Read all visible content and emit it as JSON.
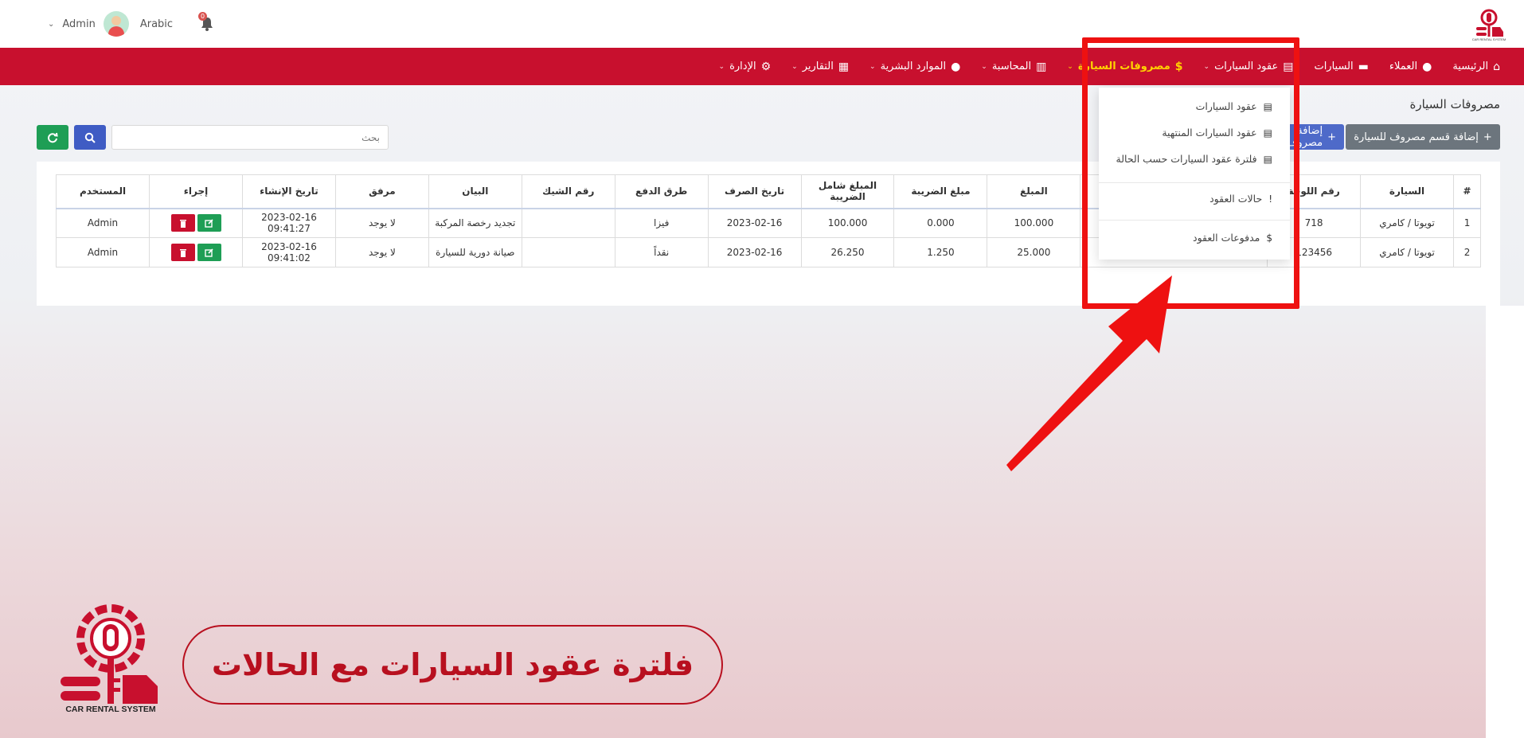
{
  "header": {
    "user_name": "Admin",
    "language": "Arabic",
    "notification_count": "0"
  },
  "nav": {
    "items": [
      {
        "label": "الرئيسية",
        "icon": "home-icon"
      },
      {
        "label": "العملاء",
        "icon": "user-icon"
      },
      {
        "label": "السيارات",
        "icon": "car-icon"
      },
      {
        "label": "عقود السيارات",
        "icon": "file-icon"
      },
      {
        "label": "مصروفات السيارة",
        "icon": "dollar-icon"
      },
      {
        "label": "المحاسبة",
        "icon": "bank-icon"
      },
      {
        "label": "الموارد البشرية",
        "icon": "users-icon"
      },
      {
        "label": "التقارير",
        "icon": "chart-icon"
      },
      {
        "label": "الإدارة",
        "icon": "gear-icon"
      }
    ]
  },
  "dropdown": {
    "items": [
      "عقود السيارات",
      "عقود السيارات المنتهية",
      "فلترة عقود السيارات حسب الحالة",
      "حالات العقود",
      "مدفوعات العقود"
    ]
  },
  "page": {
    "title": "مصروفات السيارة",
    "add_category_label": "إضافة قسم مصروف للسيارة",
    "add_label": "إضافة مصروف",
    "search_placeholder": "بحث"
  },
  "table": {
    "headers": [
      "#",
      "السيارة",
      "رقم اللوحة",
      "",
      "المبلغ",
      "مبلغ الضريبة",
      "المبلغ شامل الضريبة",
      "تاريخ الصرف",
      "طرق الدفع",
      "رقم الشيك",
      "البيان",
      "مرفق",
      "تاريخ الإنشاء",
      "إجراء",
      "المستخدم"
    ],
    "rows": [
      [
        "1",
        "تويوتا / كامري",
        "718",
        "",
        "100.000",
        "0.000",
        "100.000",
        "2023-02-16",
        "فيزا",
        "",
        "تجديد رخصة المركبة",
        "لا يوجد",
        "2023-02-16 09:41:27",
        "",
        "Admin"
      ],
      [
        "2",
        "تويوتا / كامري",
        "123456",
        "",
        "25.000",
        "1.250",
        "26.250",
        "2023-02-16",
        "نقداً",
        "",
        "صيانة دورية للسيارة",
        "لا يوجد",
        "2023-02-16 09:41:02",
        "",
        "Admin"
      ]
    ]
  },
  "banner": {
    "text": "فلترة عقود السيارات مع الحالات",
    "logo_caption": "CAR RENTAL SYSTEM"
  },
  "colors": {
    "nav_red": "#c8102e",
    "active_yellow": "#ffd200",
    "highlight_red": "#ee1111",
    "success_green": "#1e9e55",
    "primary_blue": "#3f5cc4"
  }
}
